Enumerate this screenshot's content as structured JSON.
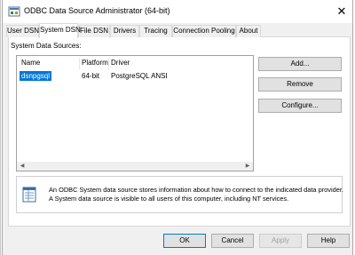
{
  "window": {
    "title": "ODBC Data Source Administrator (64-bit)",
    "close_glyph": "✕"
  },
  "tabs": [
    {
      "label": "User DSN",
      "active": false
    },
    {
      "label": "System DSN",
      "active": true
    },
    {
      "label": "File DSN",
      "active": false
    },
    {
      "label": "Drivers",
      "active": false
    },
    {
      "label": "Tracing",
      "active": false
    },
    {
      "label": "Connection Pooling",
      "active": false
    },
    {
      "label": "About",
      "active": false
    }
  ],
  "panel": {
    "label": "System Data Sources:"
  },
  "list": {
    "columns": [
      "Name",
      "Platform",
      "Driver"
    ],
    "rows": [
      {
        "name": "dsnpgsql",
        "platform": "64-bit",
        "driver": "PostgreSQL ANSI",
        "selected": true
      }
    ]
  },
  "side_buttons": {
    "add": "Add...",
    "remove": "Remove",
    "configure": "Configure..."
  },
  "info": {
    "line1": "An ODBC System data source stores information about how to connect to the indicated data provider.",
    "line2": "A System data source is visible to all users of this computer, including NT services."
  },
  "footer_buttons": {
    "ok": "OK",
    "cancel": "Cancel",
    "apply": "Apply",
    "help": "Help"
  },
  "colors": {
    "selection": "#0078d7",
    "window_bg": "#f0f0f0"
  }
}
